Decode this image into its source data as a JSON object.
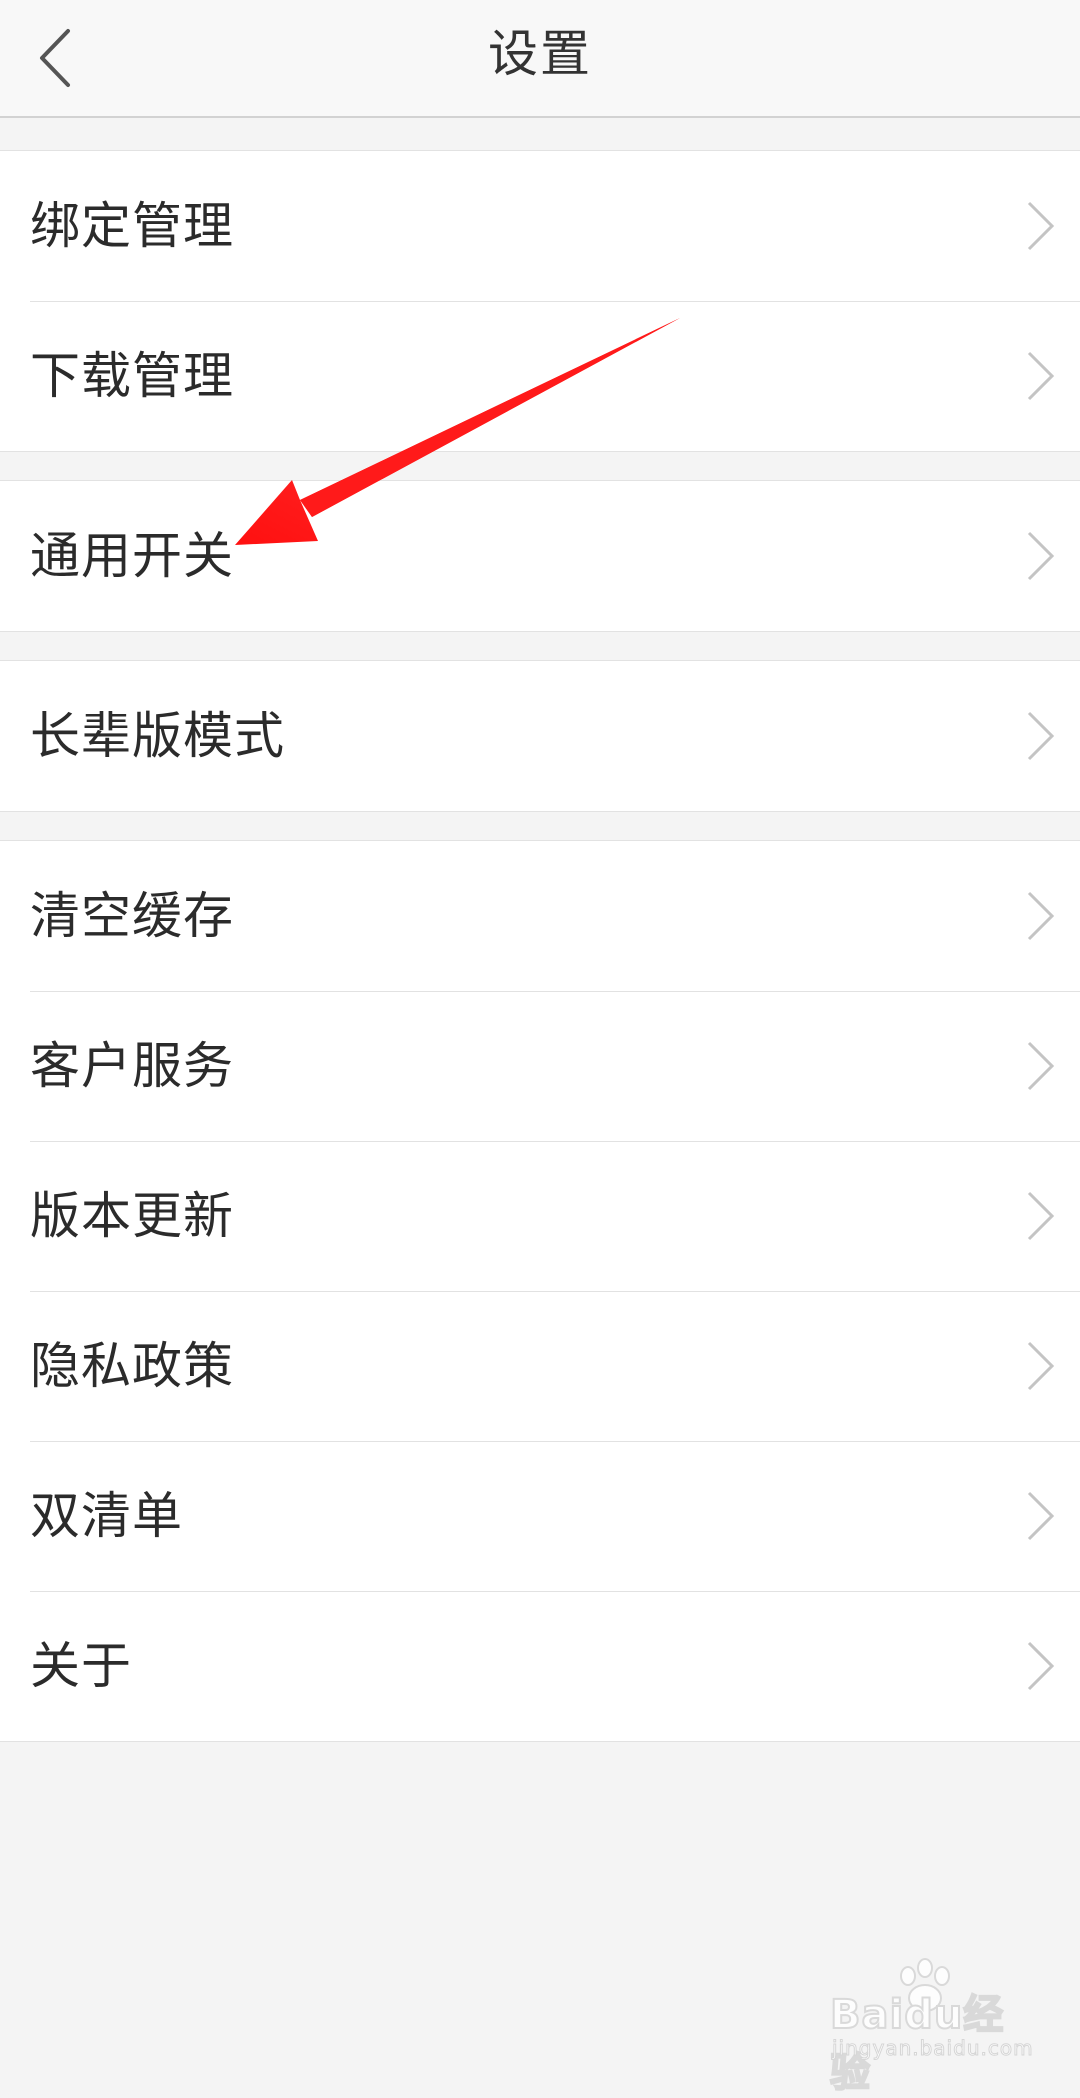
{
  "header": {
    "title": "设置"
  },
  "groups": [
    {
      "items": [
        {
          "label": "绑定管理"
        },
        {
          "label": "下载管理"
        }
      ]
    },
    {
      "items": [
        {
          "label": "通用开关"
        }
      ]
    },
    {
      "items": [
        {
          "label": "长辈版模式"
        }
      ]
    },
    {
      "items": [
        {
          "label": "清空缓存"
        },
        {
          "label": "客户服务"
        },
        {
          "label": "版本更新"
        },
        {
          "label": "隐私政策"
        },
        {
          "label": "双清单"
        },
        {
          "label": "关于"
        }
      ]
    }
  ],
  "icons": {
    "back": "chevron-left-icon",
    "row_arrow": "chevron-right-icon"
  },
  "annotation": {
    "color": "#ff1a1a",
    "points_to": "通用开关"
  },
  "watermark": {
    "brand": "Baidu经验",
    "url": "jingyan.baidu.com"
  },
  "colors": {
    "background": "#f4f4f4",
    "row_background": "#ffffff",
    "text": "#2b2b2b",
    "chevron": "#c4c4c4"
  }
}
